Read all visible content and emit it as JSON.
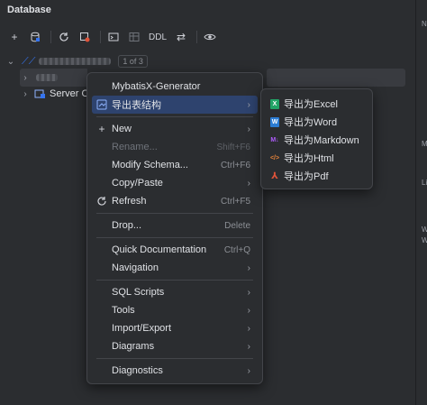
{
  "panel": {
    "title": "Database"
  },
  "toolbar": {
    "buttons": [
      {
        "name": "add-icon",
        "glyph": "+"
      },
      {
        "name": "datasource-properties-icon",
        "glyph": "⛁"
      },
      {
        "name": "refresh-icon",
        "glyph": "⟳"
      },
      {
        "name": "stop-icon",
        "glyph": "⊡"
      },
      {
        "name": "console-icon",
        "glyph": "▭"
      },
      {
        "name": "table-icon",
        "glyph": "▦"
      }
    ],
    "ddl_label": "DDL",
    "jump_glyph": "⇄",
    "view_glyph": "◉"
  },
  "tree": {
    "match_count": "1 of 3",
    "server_label": "Server O"
  },
  "context_menu": {
    "items": [
      {
        "label": "MybatisX-Generator",
        "shortcut": "",
        "arrow": false
      },
      {
        "label": "导出表结构",
        "shortcut": "",
        "arrow": true
      },
      {
        "label": "New",
        "shortcut": "",
        "arrow": true
      },
      {
        "label": "Rename...",
        "shortcut": "Shift+F6",
        "arrow": false
      },
      {
        "label": "Modify Schema...",
        "shortcut": "Ctrl+F6",
        "arrow": false
      },
      {
        "label": "Copy/Paste",
        "shortcut": "",
        "arrow": true
      },
      {
        "label": "Refresh",
        "shortcut": "Ctrl+F5",
        "arrow": false
      },
      {
        "label": "Drop...",
        "shortcut": "Delete",
        "arrow": false
      },
      {
        "label": "Quick Documentation",
        "shortcut": "Ctrl+Q",
        "arrow": false
      },
      {
        "label": "Navigation",
        "shortcut": "",
        "arrow": true
      },
      {
        "label": "SQL Scripts",
        "shortcut": "",
        "arrow": true
      },
      {
        "label": "Tools",
        "shortcut": "",
        "arrow": true
      },
      {
        "label": "Import/Export",
        "shortcut": "",
        "arrow": true
      },
      {
        "label": "Diagrams",
        "shortcut": "",
        "arrow": true
      },
      {
        "label": "Diagnostics",
        "shortcut": "",
        "arrow": true
      }
    ],
    "arrow_glyph": "›"
  },
  "submenu": {
    "items": [
      {
        "label": "导出为Excel",
        "badge": "X",
        "color": "#21a366"
      },
      {
        "label": "导出为Word",
        "badge": "W",
        "color": "#2b7cd3"
      },
      {
        "label": "导出为Markdown",
        "badge": "M↓",
        "color": "#b05cff"
      },
      {
        "label": "导出为Html",
        "badge": "</>",
        "color": "#e8843a"
      },
      {
        "label": "导出为Pdf",
        "badge": "⅄",
        "color": "#e0533a"
      }
    ]
  },
  "right_strip": {
    "marks": [
      "Ne",
      "M",
      "Li",
      "W",
      "W"
    ]
  },
  "colors": {
    "background": "#2b2d30",
    "selected": "#2e436e",
    "accent": "#3574f0"
  }
}
